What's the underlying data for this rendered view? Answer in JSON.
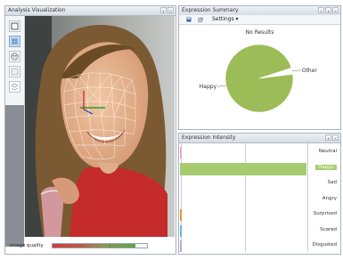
{
  "panels": {
    "analysis": {
      "title": "Analysis Visualization"
    },
    "summary": {
      "title": "Expression Summary"
    },
    "intensity": {
      "title": "Expression Intensity"
    }
  },
  "window_buttons": [
    "×",
    "▾",
    "×"
  ],
  "quality": {
    "label": "Image quality",
    "value_percent": 88
  },
  "summary_toolbar": {
    "settings_label": "Settings ▾"
  },
  "chart_data": {
    "type": "pie",
    "title": "No Results",
    "slices": [
      {
        "label": "Happy",
        "value": 97,
        "color": "#9cbc58"
      },
      {
        "label": "Other",
        "value": 3,
        "color": "#ffffff"
      }
    ]
  },
  "intensity": {
    "categories": [
      {
        "label": "Neutral",
        "value": 0
      },
      {
        "label": "Happy",
        "value": 1.0
      },
      {
        "label": "Sad",
        "value": 0
      },
      {
        "label": "Angry",
        "value": 0
      },
      {
        "label": "Surprised",
        "value": 0
      },
      {
        "label": "Scared",
        "value": 0
      },
      {
        "label": "Disgusted",
        "value": 0
      }
    ],
    "highlight": "Happy",
    "bar_color": "#a7cc6e"
  },
  "colors": {
    "happy": "#9cbc58",
    "accent": "#a7cc6e"
  }
}
